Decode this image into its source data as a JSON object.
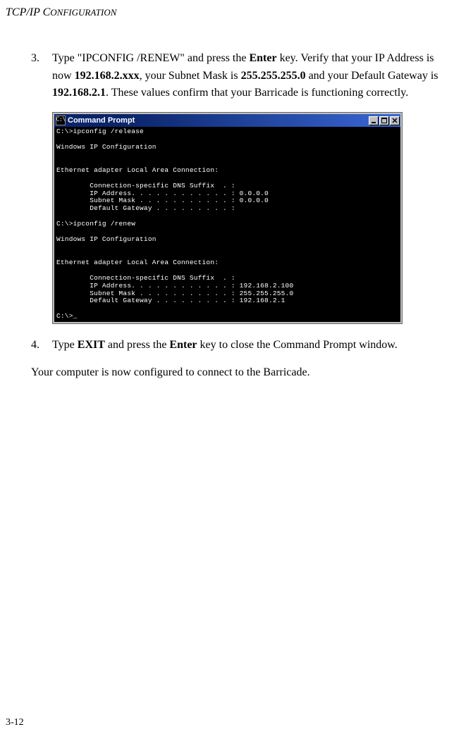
{
  "header": {
    "running_title": "TCP/IP CONFIGURATION"
  },
  "steps": {
    "item3": {
      "number": "3.",
      "text_a": "Type \"IPCONFIG /RENEW\" and press the ",
      "text_b": " key. Verify that your IP Address is now ",
      "text_c": ", your Subnet Mask is ",
      "text_d": " and your Default Gateway is ",
      "text_e": ". These values confirm that your Barricade is functioning correctly.",
      "bold_enter": "Enter",
      "bold_ip": "192.168.2.xxx",
      "bold_mask": "255.255.255.0",
      "bold_gw": "192.168.2.1"
    },
    "item4": {
      "number": "4.",
      "text_a": "Type ",
      "bold_exit": "EXIT",
      "text_b": " and press the ",
      "bold_enter": "Enter",
      "text_c": " key to close the Command Prompt window."
    }
  },
  "cmd": {
    "titlebar_icon_text": "C:\\",
    "titlebar_title": "Command Prompt",
    "terminal_text": "C:\\>ipconfig /release\n\nWindows IP Configuration\n\n\nEthernet adapter Local Area Connection:\n\n        Connection-specific DNS Suffix  . :\n        IP Address. . . . . . . . . . . . : 0.0.0.0\n        Subnet Mask . . . . . . . . . . . : 0.0.0.0\n        Default Gateway . . . . . . . . . :\n\nC:\\>ipconfig /renew\n\nWindows IP Configuration\n\n\nEthernet adapter Local Area Connection:\n\n        Connection-specific DNS Suffix  . :\n        IP Address. . . . . . . . . . . . : 192.168.2.100\n        Subnet Mask . . . . . . . . . . . : 255.255.255.0\n        Default Gateway . . . . . . . . . : 192.168.2.1\n\nC:\\>_"
  },
  "closing": {
    "text": "Your computer is now configured to connect to the Barricade."
  },
  "footer": {
    "page": "3-12"
  }
}
